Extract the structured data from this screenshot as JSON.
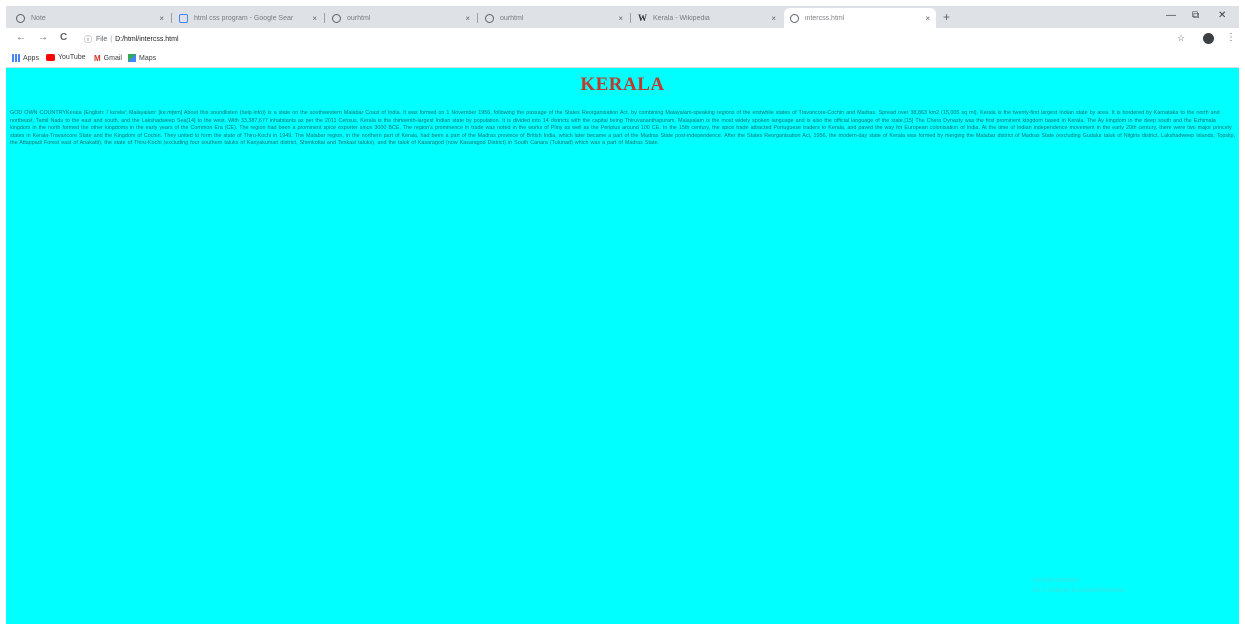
{
  "browser": {
    "tabs": [
      {
        "title": "Note",
        "icon": "globe-icon",
        "active": false
      },
      {
        "title": "html css program - Google Sear",
        "icon": "google-icon",
        "active": false
      },
      {
        "title": "ourhtml",
        "icon": "globe-icon",
        "active": false
      },
      {
        "title": "ourhtml",
        "icon": "globe-icon",
        "active": false
      },
      {
        "title": "Kerala - Wikipedia",
        "icon": "wikipedia-icon",
        "active": false
      },
      {
        "title": "intercss.html",
        "icon": "globe-icon",
        "active": true
      }
    ],
    "tab_close_glyph": "×",
    "new_tab_glyph": "+",
    "window_controls": {
      "minimize": "—",
      "maximize": "⧉",
      "close": "✕"
    },
    "toolbar": {
      "back": "←",
      "forward": "→",
      "reload": "C",
      "info_glyph": "ⓘ",
      "scheme": "File",
      "separator": "|",
      "url": "D:/html/intercss.html",
      "star": "☆",
      "menu": "⋮"
    },
    "bookmarks": [
      {
        "label": "Apps",
        "icon": "apps-icon"
      },
      {
        "label": "YouTube",
        "icon": "youtube-icon"
      },
      {
        "label": "Gmail",
        "icon": "gmail-icon"
      },
      {
        "label": "Maps",
        "icon": "maps-icon"
      }
    ]
  },
  "page": {
    "background": "#00ffff",
    "heading": "KERALA",
    "heading_color": "#c0392b",
    "paragraph": "GOD OWN COUNTRYKerala (English: /ˈkɛrələ/; Malayalam: [keːɾɐɭɐm] About this soundlisten (help·info)) is a state on the southwestern Malabar Coast of India. It was formed on 1 November 1956, following the passage of the States Reorganisation Act, by combining Malayalam-speaking regions of the erstwhile states of Travancore-Cochin and Madras. Spread over 38,863 km2 (15,005 sq mi), Kerala is the twenty-first largest Indian state by area. It is bordered by Karnataka to the north and northeast, Tamil Nadu to the east and south, and the Lakshadweep Sea[14] to the west. With 33,387,677 inhabitants as per the 2011 Census, Kerala is the thirteenth-largest Indian state by population. It is divided into 14 districts with the capital being Thiruvananthapuram. Malayalam is the most widely spoken language and is also the official language of the state.[15] The Chera Dynasty was the first prominent kingdom based in Kerala. The Ay kingdom in the deep south and the Ezhimala kingdom in the north formed the other kingdoms in the early years of the Common Era (CE). The region had been a prominent spice exporter since 3000 BCE. The region's prominence in trade was noted in the works of Pliny as well as the Periplus around 100 CE. In the 15th century, the spice trade attracted Portuguese traders to Kerala, and paved the way for European colonisation of India. At the time of Indian independence movement in the early 20th century, there were two major princely states in Kerala-Travancore State and the Kingdom of Cochin. They united to form the state of Thiru-Kochi in 1949. The Malabar region, in the northern part of Kerala, had been a part of the Madras province of British India, which later became a part of the Madras State post-independence. After the States Reorganisation Act, 1956, the modern-day state of Kerala was formed by merging the Malabar district of Madras State (excluding Gudalur taluk of Nilgiris district, Lakshadweep Islands, Topslip, the Attappadi Forest east of Anakatti), the state of Thiru-Kochi (excluding four southern taluks of Kanyakumari district, Shenkottai and Tenkasi taluks), and the taluk of Kasaragod (now Kasaragod District) in South Canara (Tulunad) which was a part of Madras State.",
    "watermark_line1": "Activate Windows",
    "watermark_line2": "Go to Settings to activate Windows."
  }
}
